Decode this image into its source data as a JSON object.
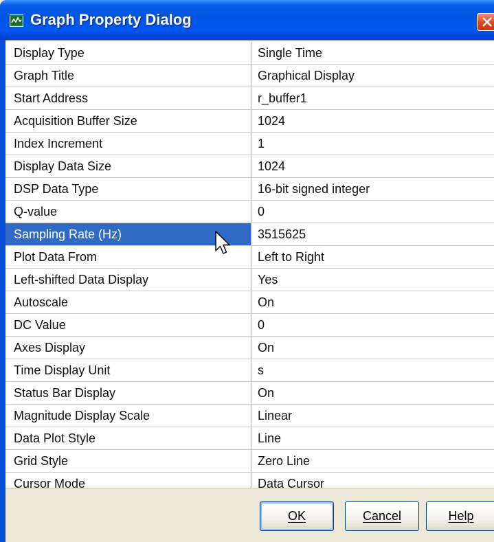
{
  "window": {
    "title": "Graph Property Dialog",
    "title_icon": "graph-icon",
    "close_icon": "close-icon"
  },
  "properties": [
    {
      "name": "Display Type",
      "value": "Single Time"
    },
    {
      "name": "Graph Title",
      "value": "Graphical Display"
    },
    {
      "name": "Start Address",
      "value": "r_buffer1"
    },
    {
      "name": "Acquisition Buffer Size",
      "value": "1024"
    },
    {
      "name": "Index Increment",
      "value": "1"
    },
    {
      "name": "Display Data Size",
      "value": "1024"
    },
    {
      "name": "DSP Data Type",
      "value": "16-bit signed integer"
    },
    {
      "name": "Q-value",
      "value": "0"
    },
    {
      "name": "Sampling Rate (Hz)",
      "value": "3515625"
    },
    {
      "name": "Plot Data From",
      "value": "Left to Right"
    },
    {
      "name": "Left-shifted Data Display",
      "value": "Yes"
    },
    {
      "name": "Autoscale",
      "value": "On"
    },
    {
      "name": "DC Value",
      "value": "0"
    },
    {
      "name": "Axes Display",
      "value": "On"
    },
    {
      "name": "Time Display Unit",
      "value": "s"
    },
    {
      "name": "Status Bar Display",
      "value": "On"
    },
    {
      "name": "Magnitude Display Scale",
      "value": "Linear"
    },
    {
      "name": "Data Plot Style",
      "value": "Line"
    },
    {
      "name": "Grid Style",
      "value": "Zero Line"
    },
    {
      "name": "Cursor Mode",
      "value": "Data Cursor"
    }
  ],
  "selected_property": "Sampling Rate (Hz)",
  "buttons": {
    "ok": "OK",
    "cancel": "Cancel",
    "help": "Help"
  },
  "colors": {
    "selection": "#316ac5",
    "titlebar": "#0054e3",
    "close_button": "#e0481f"
  }
}
